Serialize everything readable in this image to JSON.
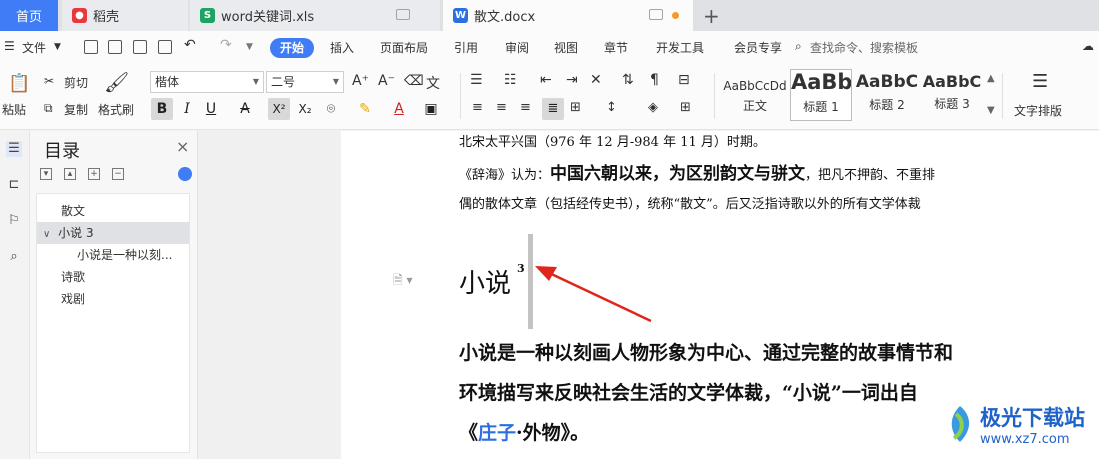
{
  "tabs": {
    "home": "首页",
    "tab1": "稻壳",
    "tab2": "word关键词.xls",
    "tab3": "散文.docx",
    "add": "+"
  },
  "menu": {
    "file": "文件",
    "start": "开始",
    "items": [
      "插入",
      "页面布局",
      "引用",
      "审阅",
      "视图",
      "章节",
      "开发工具",
      "会员专享"
    ],
    "search": "查找命令、搜索模板"
  },
  "ribbon": {
    "paste": "粘贴",
    "cut": "剪切",
    "copy": "复制",
    "format_painter": "格式刷",
    "font_name": "楷体",
    "font_size": "二号",
    "bold": "B",
    "italic": "I",
    "underline": "U",
    "strike": "A",
    "superscript": "X²",
    "subscript": "X₂",
    "styles": [
      {
        "sample": "AaBbCcDd",
        "name": "正文"
      },
      {
        "sample": "AaBb",
        "name": "标题 1"
      },
      {
        "sample": "AaBbC",
        "name": "标题 2"
      },
      {
        "sample": "AaBbC",
        "name": "标题 3"
      }
    ],
    "text_layout": "文字排版"
  },
  "toc": {
    "title": "目录",
    "close": "×",
    "items": [
      {
        "label": "散文"
      },
      {
        "label": "小说 3"
      },
      {
        "label": "小说是一种以刻..."
      },
      {
        "label": "诗歌"
      },
      {
        "label": "戏剧"
      }
    ]
  },
  "document": {
    "line1": "北宋太平兴国（976 年 12 月-984 年 11 月）时期。",
    "line2_pre": "《辞海》认为：",
    "line2_bold": "中国六朝以来，为区别韵文与骈文",
    "line2_post": "，把凡不押韵、不重排",
    "line3": "偶的散体文章（包括经传史书），统称“散文”。后又泛指诗歌以外的所有文学体裁",
    "heading": "小说",
    "heading_sup": "3",
    "para1": "小说是一种以刻画人物形象为中心、通过完整的故事情节和",
    "para2": "环境描写来反映社会生活的文学体裁，“小说”一词出自",
    "para3_pre": "《",
    "para3_link": "庄子",
    "para3_post": "·外物》。"
  },
  "watermark": {
    "text": "极光下载站",
    "url": "www.xz7.com"
  }
}
